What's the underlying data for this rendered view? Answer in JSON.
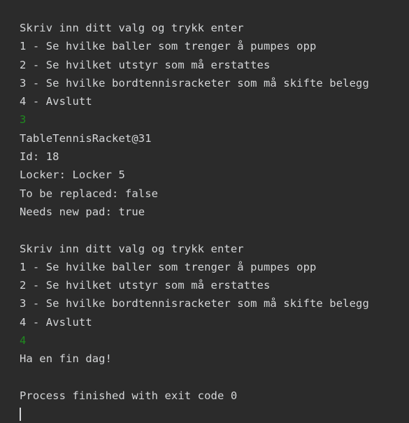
{
  "colors": {
    "background": "#2b2b2b",
    "text": "#d4d6d8",
    "user_input": "#1f8a1f"
  },
  "console": {
    "menu1": {
      "prompt": "Skriv inn ditt valg og trykk enter",
      "option1": "1 - Se hvilke baller som trenger å pumpes opp",
      "option2": "2 - Se hvilket utstyr som må erstattes",
      "option3": "3 - Se hvilke bordtennisracketer som må skifte belegg",
      "option4": "4 - Avslutt"
    },
    "input1": "3",
    "result": {
      "object": "TableTennisRacket@31",
      "id": "Id: 18",
      "locker": "Locker: Locker 5",
      "replaced": "To be replaced: false",
      "new_pad": "Needs new pad: true"
    },
    "menu2": {
      "prompt": "Skriv inn ditt valg og trykk enter",
      "option1": "1 - Se hvilke baller som trenger å pumpes opp",
      "option2": "2 - Se hvilket utstyr som må erstattes",
      "option3": "3 - Se hvilke bordtennisracketer som må skifte belegg",
      "option4": "4 - Avslutt"
    },
    "input2": "4",
    "farewell": "Ha en fin dag!",
    "exit_message": "Process finished with exit code 0"
  }
}
